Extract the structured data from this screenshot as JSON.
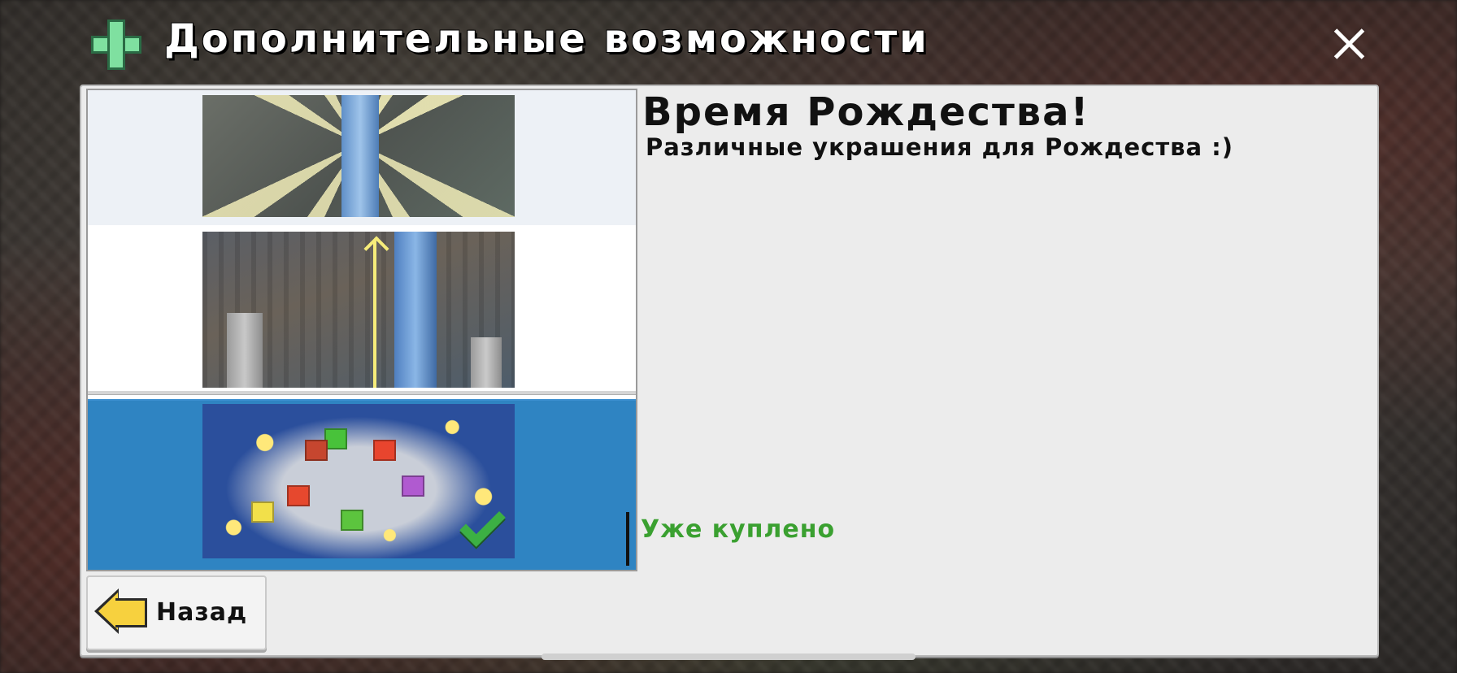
{
  "header": {
    "title": "Дополнительные возможности",
    "icon": "plus-icon",
    "close_icon": "close-icon"
  },
  "list": {
    "items": [
      {
        "name": "spotlight-tower",
        "selected": false
      },
      {
        "name": "tall-tower",
        "selected": false
      },
      {
        "name": "christmas-decorations",
        "selected": true,
        "purchased": true
      }
    ]
  },
  "detail": {
    "title": "Время Рождества!",
    "description": "Различные украшения для Рождества :)",
    "status": "Уже куплено",
    "status_color": "#3aa030"
  },
  "footer": {
    "back_label": "Назад",
    "back_icon": "arrow-left-icon"
  },
  "colors": {
    "selected_row": "#2f84c2",
    "panel_bg": "#ececec",
    "plus_green": "#7fe0a0",
    "arrow_yellow": "#f7d13e"
  }
}
